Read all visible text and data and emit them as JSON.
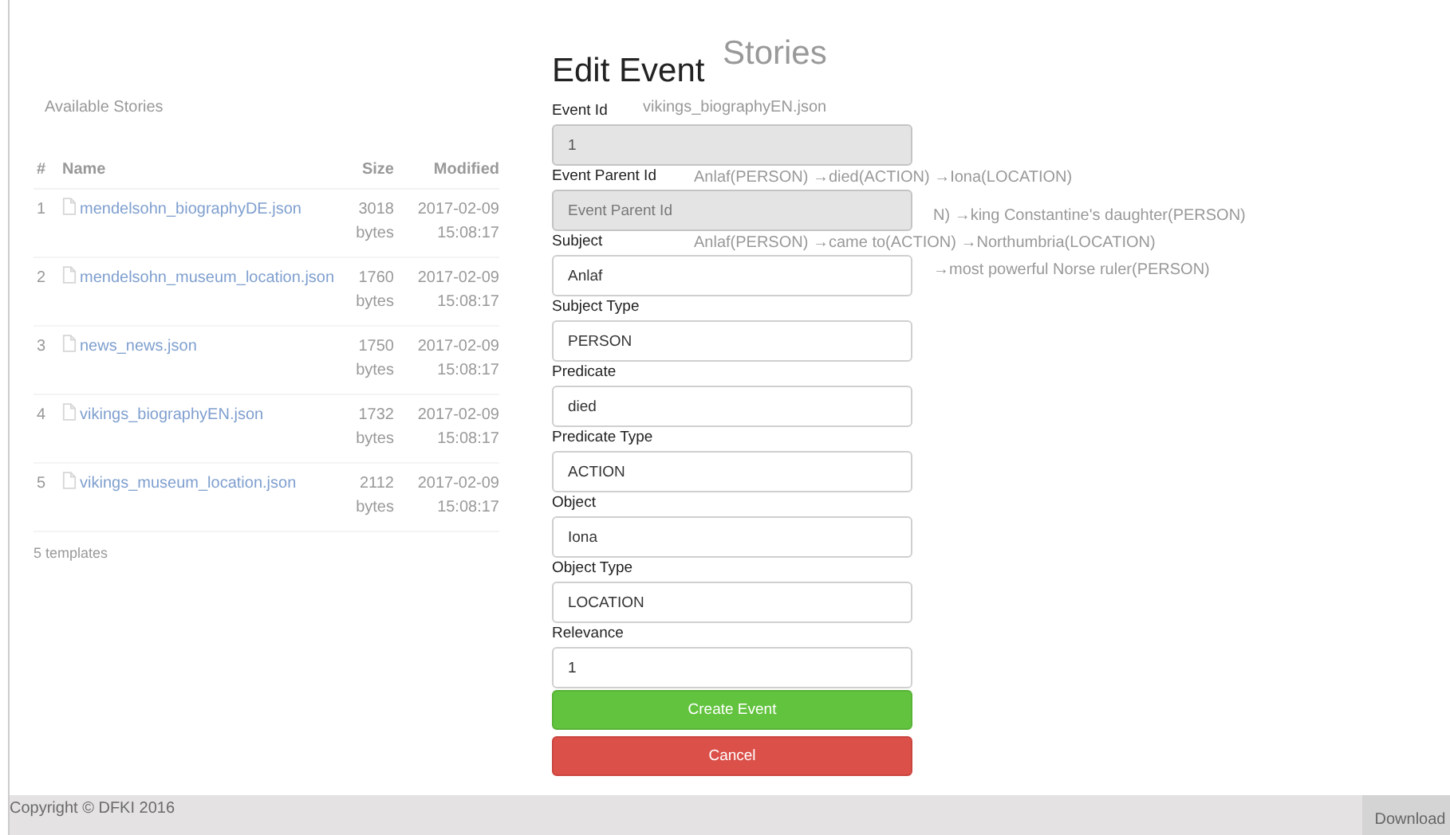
{
  "stories_panel": {
    "title": "Available Stories",
    "columns": [
      "#",
      "Name",
      "Size",
      "Modified"
    ],
    "rows": [
      {
        "index": "1",
        "name": "mendelsohn_biographyDE.json",
        "size": "3018 bytes",
        "date": "2017-02-09",
        "time": "15:08:17"
      },
      {
        "index": "2",
        "name": "mendelsohn_museum_location.json",
        "size": "1760 bytes",
        "date": "2017-02-09",
        "time": "15:08:17"
      },
      {
        "index": "3",
        "name": "news_news.json",
        "size": "1750 bytes",
        "date": "2017-02-09",
        "time": "15:08:17"
      },
      {
        "index": "4",
        "name": "vikings_biographyEN.json",
        "size": "1732 bytes",
        "date": "2017-02-09",
        "time": "15:08:17"
      },
      {
        "index": "5",
        "name": "vikings_museum_location.json",
        "size": "2112 bytes",
        "date": "2017-02-09",
        "time": "15:08:17"
      }
    ],
    "count": "5 templates"
  },
  "story": {
    "title": "Stories",
    "file": "vikings_biographyEN.json",
    "events": [
      {
        "text": "Anlaf(PERSON) →died(ACTION) →Iona(LOCATION)"
      },
      {
        "text": "N) →king Constantine's daughter(PERSON)"
      },
      {
        "text": "Anlaf(PERSON) →came to(ACTION) →Northumbria(LOCATION)"
      },
      {
        "text": "→most powerful Norse ruler(PERSON)"
      }
    ]
  },
  "dialog": {
    "title": "Edit Event",
    "fields": [
      {
        "label": "Event Id",
        "value": "1",
        "disabled": true
      },
      {
        "label": "Event Parent Id",
        "placeholder": "Event Parent Id",
        "disabled": true
      },
      {
        "label": "Subject",
        "value": "Anlaf",
        "disabled": false
      },
      {
        "label": "Subject Type",
        "value": "PERSON",
        "disabled": false
      },
      {
        "label": "Predicate",
        "value": "died",
        "disabled": false
      },
      {
        "label": "Predicate Type",
        "value": "ACTION",
        "disabled": false
      },
      {
        "label": "Object",
        "value": "Iona",
        "disabled": false
      },
      {
        "label": "Object Type",
        "value": "LOCATION",
        "disabled": false
      },
      {
        "label": "Relevance",
        "value": "1",
        "disabled": false
      }
    ],
    "buttons": [
      {
        "label": "Create Event",
        "kind": "primary"
      },
      {
        "label": "Cancel",
        "kind": "danger"
      }
    ]
  },
  "footer": {
    "copyright": "Copyright © DFKI 2016",
    "button": "Download"
  }
}
